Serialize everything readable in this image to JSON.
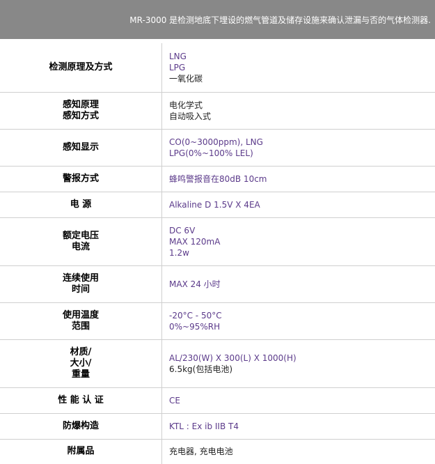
{
  "header": {
    "description": "MR-3000 是检测地底下埋设的燃气管道及储存设施来确认泄漏与否的气体检测器."
  },
  "specs": [
    {
      "label": [
        "检测原理及方式"
      ],
      "values": [
        "LNG",
        "LPG",
        "一氧化碳"
      ]
    },
    {
      "label": [
        "感知原理",
        "感知方式"
      ],
      "values": [
        "电化学式",
        "自动吸入式"
      ]
    },
    {
      "label": [
        "感知显示"
      ],
      "values": [
        "CO(0~3000ppm), LNG",
        "LPG(0%~100% LEL)"
      ]
    },
    {
      "label": [
        "警报方式"
      ],
      "values": [
        "蜂鸣警报音在80dB 10cm"
      ]
    },
    {
      "label": [
        "电 源"
      ],
      "values": [
        "Alkaline D 1.5V X 4EA"
      ]
    },
    {
      "label": [
        "额定电压",
        "电流"
      ],
      "values": [
        "DC 6V",
        "MAX 120mA",
        "1.2w"
      ]
    },
    {
      "label": [
        "连续使用",
        "时间"
      ],
      "values": [
        "MAX 24 小时"
      ]
    },
    {
      "label": [
        "使用温度",
        "范围"
      ],
      "values": [
        "-20°C - 50°C",
        "0%~95%RH"
      ]
    },
    {
      "label": [
        "材质/",
        "大小/",
        "重量"
      ],
      "values": [
        "AL/230(W) X 300(L) X 1000(H)",
        "6.5kg(包括电池)"
      ]
    },
    {
      "label": [
        "性 能 认 证"
      ],
      "values": [
        "CE"
      ]
    },
    {
      "label": [
        "防爆构造"
      ],
      "values": [
        "KTL : Ex ib IIB T4"
      ]
    },
    {
      "label": [
        "附属品"
      ],
      "values": [
        "充电器, 充电电池"
      ]
    }
  ]
}
